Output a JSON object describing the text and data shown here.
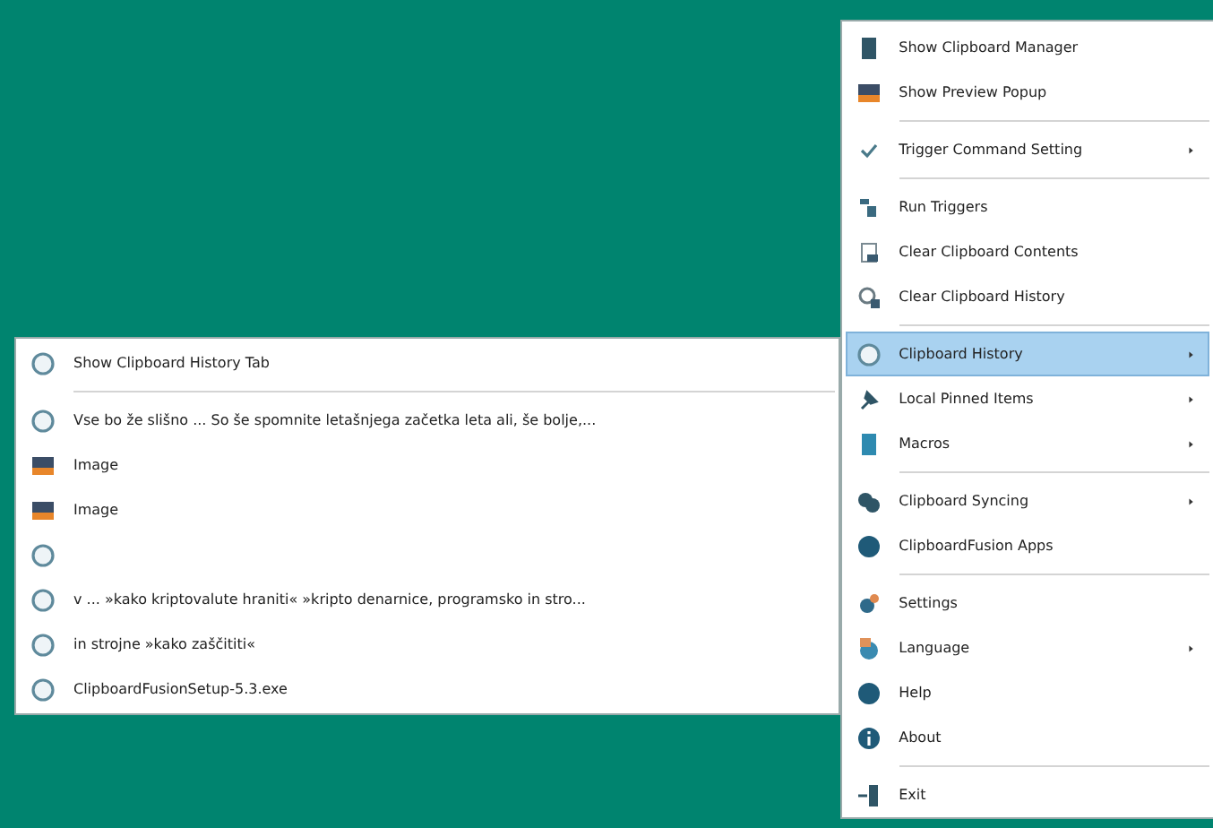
{
  "menu": {
    "items": [
      {
        "kind": "item",
        "label": "Show Clipboard Manager",
        "submenu": false,
        "selected": false
      },
      {
        "kind": "item",
        "label": "Show Preview Popup",
        "submenu": false,
        "selected": false
      },
      {
        "kind": "separator"
      },
      {
        "kind": "item",
        "label": "Trigger Command Setting",
        "submenu": true,
        "selected": false
      },
      {
        "kind": "separator"
      },
      {
        "kind": "item",
        "label": "Run Triggers",
        "submenu": false,
        "selected": false
      },
      {
        "kind": "item",
        "label": "Clear Clipboard Contents",
        "submenu": false,
        "selected": false
      },
      {
        "kind": "item",
        "label": "Clear Clipboard History",
        "submenu": false,
        "selected": false
      },
      {
        "kind": "separator"
      },
      {
        "kind": "item",
        "label": "Clipboard History",
        "submenu": true,
        "selected": true
      },
      {
        "kind": "item",
        "label": "Local Pinned Items",
        "submenu": true,
        "selected": false
      },
      {
        "kind": "item",
        "label": "Macros",
        "submenu": true,
        "selected": false
      },
      {
        "kind": "separator"
      },
      {
        "kind": "item",
        "label": "Clipboard Syncing",
        "submenu": true,
        "selected": false
      },
      {
        "kind": "item",
        "label": "ClipboardFusion Apps",
        "submenu": false,
        "selected": false
      },
      {
        "kind": "separator"
      },
      {
        "kind": "item",
        "label": "Settings",
        "submenu": false,
        "selected": false
      },
      {
        "kind": "item",
        "label": "Language",
        "submenu": true,
        "selected": false
      },
      {
        "kind": "item",
        "label": "Help",
        "submenu": false,
        "selected": false
      },
      {
        "kind": "item",
        "label": "About",
        "submenu": false,
        "selected": false
      },
      {
        "kind": "separator"
      },
      {
        "kind": "item",
        "label": "Exit",
        "submenu": false,
        "selected": false
      }
    ]
  },
  "submenu": {
    "items": [
      {
        "kind": "text",
        "label": "Show Clipboard History Tab"
      },
      {
        "kind": "separator"
      },
      {
        "kind": "text",
        "label": "Vse bo že slišno ... So še spomnite letašnjega začetka leta ali, še bolje,..."
      },
      {
        "kind": "image",
        "label": "Image"
      },
      {
        "kind": "image",
        "label": "Image"
      },
      {
        "kind": "text"
      },
      {
        "kind": "text",
        "label": "v ... »kako kriptovalute hraniti« »kripto denarnice, programsko in stro..."
      },
      {
        "kind": "text",
        "label": "in strojne »kako zaščititi«"
      },
      {
        "kind": "text",
        "label": "ClipboardFusionSetup-5.3.exe"
      }
    ]
  }
}
